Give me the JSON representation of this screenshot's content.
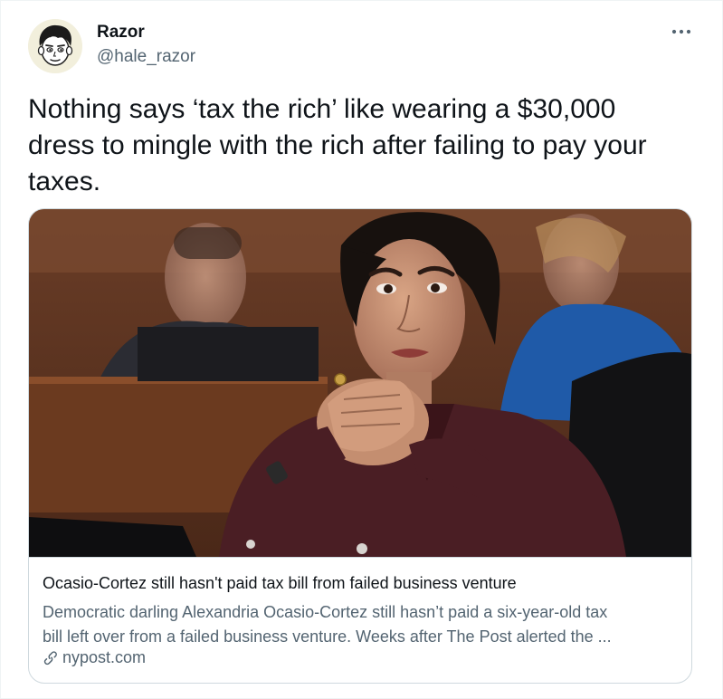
{
  "author": {
    "name": "Razor",
    "handle": "@hale_razor"
  },
  "tweet": {
    "text": "Nothing says ‘tax the rich’ like wearing a $30,000 dress to mingle with the rich after failing to pay your taxes."
  },
  "card": {
    "title": "Ocasio-Cortez still hasn't paid tax bill from failed business venture",
    "description_line1": "Democratic darling Alexandria Ocasio-Cortez still hasn’t paid a six-year-old tax",
    "description_line2": "bill left over from a failed business venture. Weeks after The Post alerted the ...",
    "domain": "nypost.com"
  },
  "icons": {
    "more": "more-horizontal-icon",
    "link": "link-icon"
  },
  "colors": {
    "primary_text": "#0f1419",
    "secondary_text": "#536471",
    "card_border": "#cfd9de"
  }
}
